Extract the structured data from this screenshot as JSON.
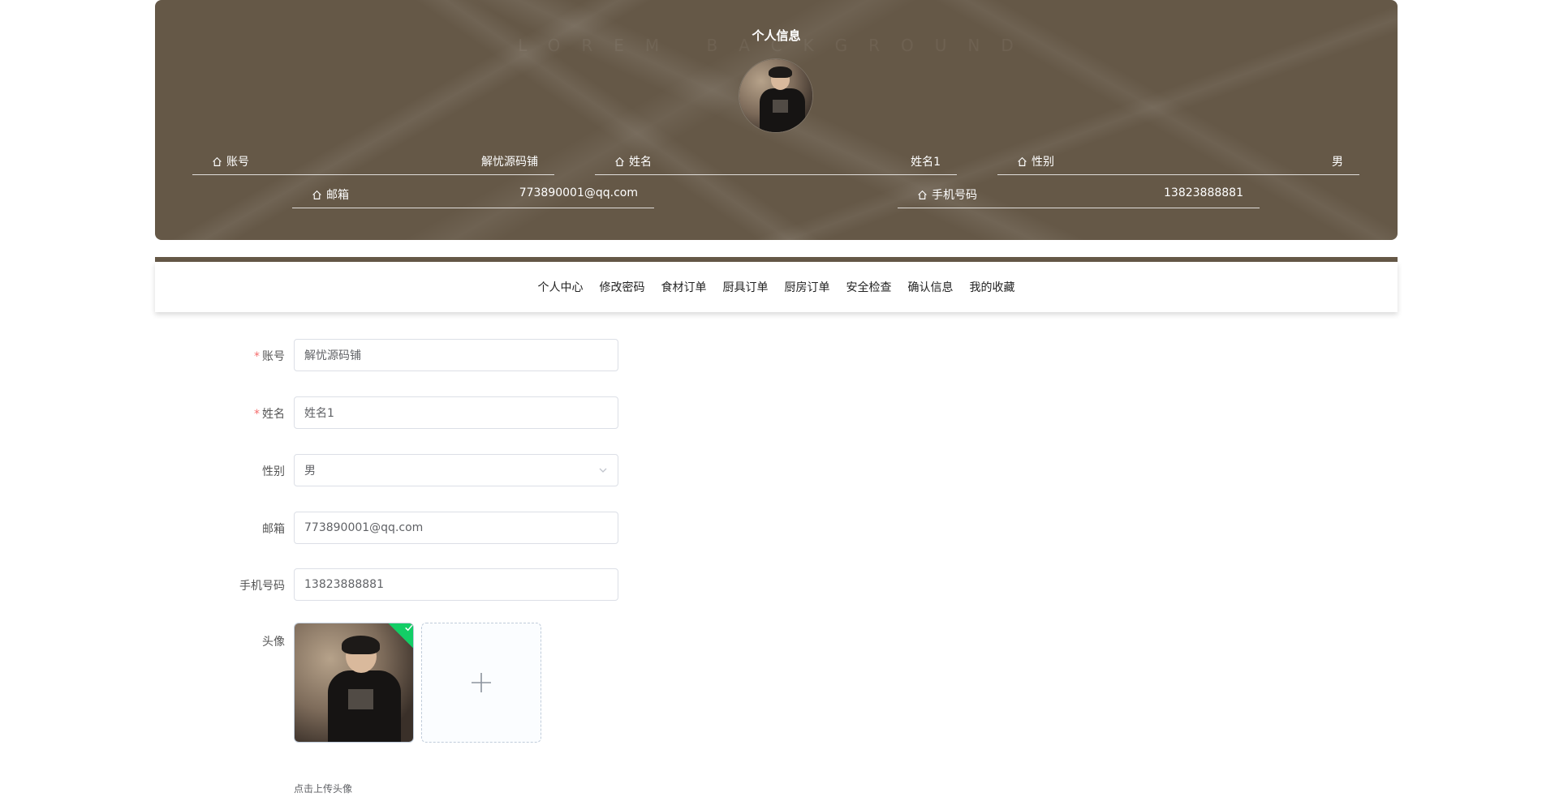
{
  "banner": {
    "title": "个人信息",
    "watermark": "LOREM BACKGROUND",
    "avatar_alt": "avatar",
    "fields": [
      {
        "label": "账号",
        "value": "解忧源码铺"
      },
      {
        "label": "姓名",
        "value": "姓名1"
      },
      {
        "label": "性别",
        "value": "男"
      },
      {
        "label": "邮箱",
        "value": "773890001@qq.com"
      },
      {
        "label": "手机号码",
        "value": "13823888881"
      }
    ]
  },
  "nav": {
    "items": [
      "个人中心",
      "修改密码",
      "食材订单",
      "厨具订单",
      "厨房订单",
      "安全检查",
      "确认信息",
      "我的收藏"
    ]
  },
  "form": {
    "account": {
      "label": "账号",
      "value": "解忧源码铺",
      "required": "*"
    },
    "name": {
      "label": "姓名",
      "value": "姓名1",
      "required": "*"
    },
    "gender": {
      "label": "性别",
      "value": "男"
    },
    "email": {
      "label": "邮箱",
      "value": "773890001@qq.com"
    },
    "phone": {
      "label": "手机号码",
      "value": "13823888881"
    },
    "avatar": {
      "label": "头像",
      "tip": "点击上传头像",
      "add_symbol": "+"
    }
  },
  "colors": {
    "banner_bg": "#655847",
    "required": "#f56c6c",
    "success": "#13ce66"
  }
}
